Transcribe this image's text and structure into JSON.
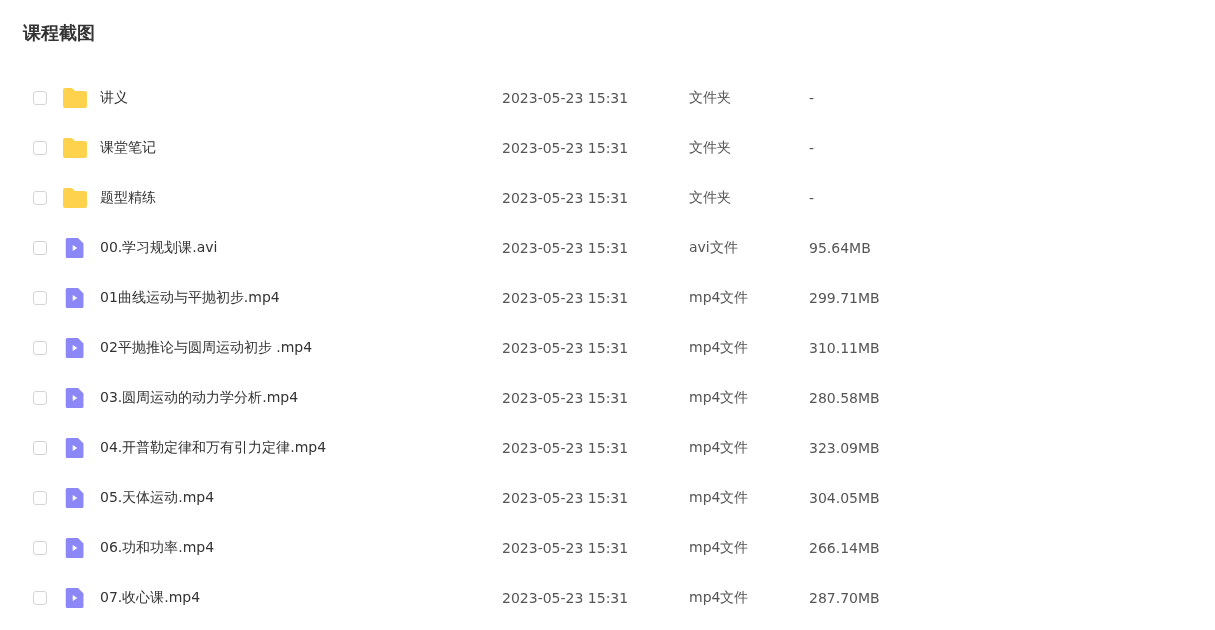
{
  "title": "课程截图",
  "files": [
    {
      "kind": "folder",
      "name": "讲义",
      "date": "2023-05-23 15:31",
      "type": "文件夹",
      "size": "-",
      "checked": false
    },
    {
      "kind": "folder",
      "name": "课堂笔记",
      "date": "2023-05-23 15:31",
      "type": "文件夹",
      "size": "-",
      "checked": false
    },
    {
      "kind": "folder",
      "name": "题型精练",
      "date": "2023-05-23 15:31",
      "type": "文件夹",
      "size": "-",
      "checked": false
    },
    {
      "kind": "video",
      "name": "00.学习规划课.avi",
      "date": "2023-05-23 15:31",
      "type": "avi文件",
      "size": "95.64MB",
      "checked": false
    },
    {
      "kind": "video",
      "name": "01曲线运动与平抛初步.mp4",
      "date": "2023-05-23 15:31",
      "type": "mp4文件",
      "size": "299.71MB",
      "checked": false
    },
    {
      "kind": "video",
      "name": "02平抛推论与圆周运动初步 .mp4",
      "date": "2023-05-23 15:31",
      "type": "mp4文件",
      "size": "310.11MB",
      "checked": false
    },
    {
      "kind": "video",
      "name": "03.圆周运动的动力学分析.mp4",
      "date": "2023-05-23 15:31",
      "type": "mp4文件",
      "size": "280.58MB",
      "checked": false
    },
    {
      "kind": "video",
      "name": "04.开普勒定律和万有引力定律.mp4",
      "date": "2023-05-23 15:31",
      "type": "mp4文件",
      "size": "323.09MB",
      "checked": false
    },
    {
      "kind": "video",
      "name": "05.天体运动.mp4",
      "date": "2023-05-23 15:31",
      "type": "mp4文件",
      "size": "304.05MB",
      "checked": false
    },
    {
      "kind": "video",
      "name": "06.功和功率.mp4",
      "date": "2023-05-23 15:31",
      "type": "mp4文件",
      "size": "266.14MB",
      "checked": false
    },
    {
      "kind": "video",
      "name": "07.收心课.mp4",
      "date": "2023-05-23 15:31",
      "type": "mp4文件",
      "size": "287.70MB",
      "checked": false
    }
  ]
}
